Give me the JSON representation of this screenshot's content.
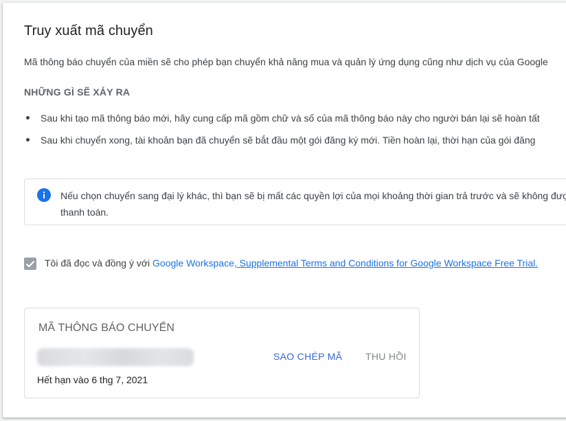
{
  "page": {
    "title": "Truy xuất mã chuyển",
    "intro": "Mã thông báo chuyển của miền sẽ cho phép bạn chuyển khả năng mua và quản lý ứng dụng cũng như dịch vụ của Google",
    "section_heading": "NHỮNG GÌ SẼ XẢY RA",
    "bullets": [
      "Sau khi tạo mã thông báo mới, hãy cung cấp mã gồm chữ và số của mã thông báo này cho người bán lại sẽ hoàn tất",
      "Sau khi chuyển xong, tài khoản bạn đã chuyển sẽ bắt đầu một gói đăng ký mới. Tiền hoàn lại, thời hạn của gói đăng"
    ],
    "notice": {
      "text": "Nếu chọn chuyển sang đại lý khác, thì bạn sẽ bị mất các quyền lợi của mọi khoảng thời gian trả trước và sẽ không được thanh toán.",
      "icon": "info-icon",
      "icon_color": "#1a73e8"
    },
    "agreement": {
      "checked": true,
      "prefix": "Tôi đã đọc và đồng ý với ",
      "link1": "Google Workspace",
      "link2": ", Supplemental Terms and Conditions for Google Workspace Free Trial."
    },
    "code_box": {
      "label": "MÃ THÔNG BÁO CHUYỂN",
      "copy_label": "SAO CHÉP MÃ",
      "revoke_label": "THU HỒI",
      "expiry": "Hết hạn vào 6 thg 7, 2021"
    }
  },
  "colors": {
    "accent": "#1a73e8",
    "copy_button": "#3367d6",
    "muted": "#80868b"
  }
}
